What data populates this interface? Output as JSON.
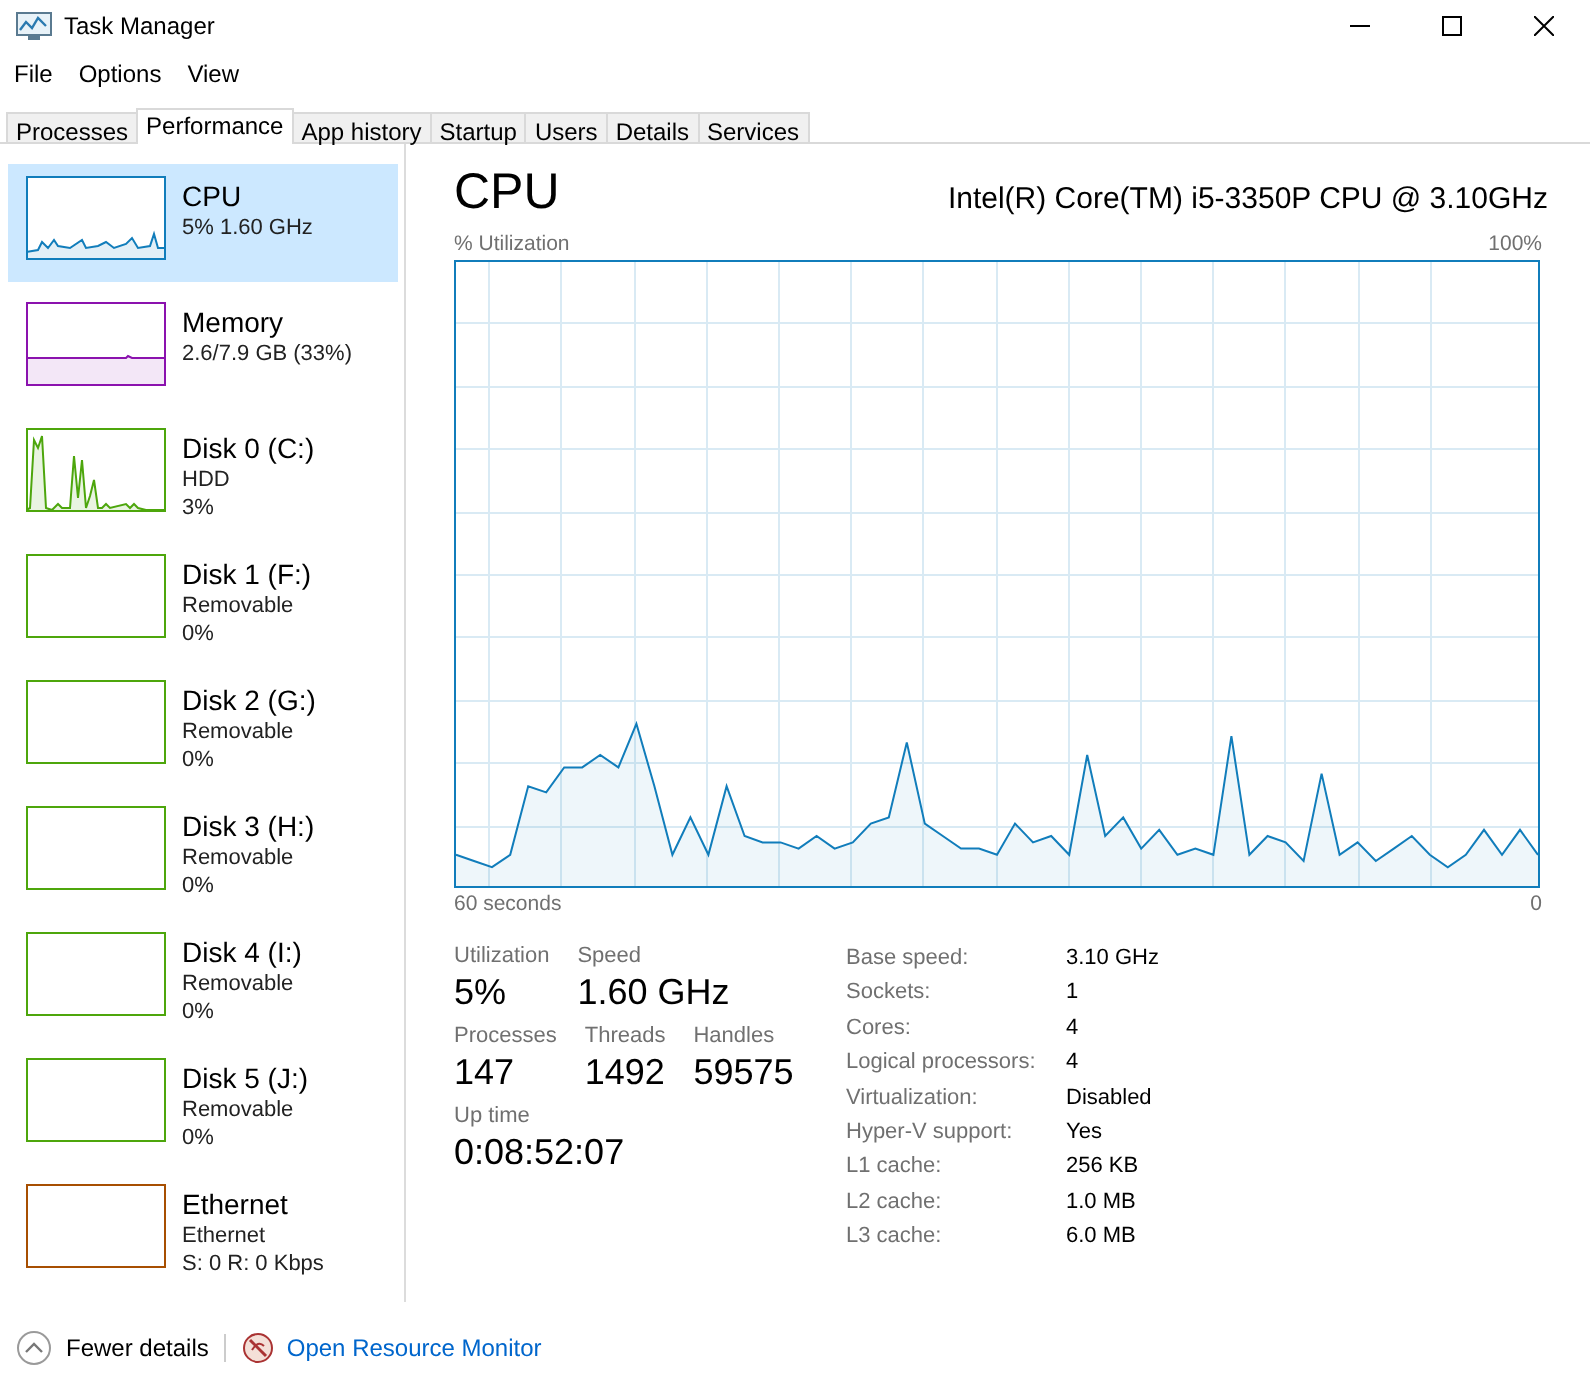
{
  "window": {
    "title": "Task Manager"
  },
  "menu": [
    "File",
    "Options",
    "View"
  ],
  "tabs": [
    {
      "label": "Processes",
      "selected": false
    },
    {
      "label": "Performance",
      "selected": true
    },
    {
      "label": "App history",
      "selected": false
    },
    {
      "label": "Startup",
      "selected": false
    },
    {
      "label": "Users",
      "selected": false
    },
    {
      "label": "Details",
      "selected": false
    },
    {
      "label": "Services",
      "selected": false
    }
  ],
  "sidebar": {
    "items": [
      {
        "kind": "cpu",
        "name": "CPU",
        "lines": [
          "5% 1.60 GHz"
        ],
        "selected": true,
        "color": "#117dbb"
      },
      {
        "kind": "memory",
        "name": "Memory",
        "lines": [
          "2.6/7.9 GB (33%)"
        ],
        "selected": false,
        "color": "#8b12ae"
      },
      {
        "kind": "disk-busy",
        "name": "Disk 0 (C:)",
        "lines": [
          "HDD",
          "3%"
        ],
        "selected": false,
        "color": "#4da60c"
      },
      {
        "kind": "disk",
        "name": "Disk 1 (F:)",
        "lines": [
          "Removable",
          "0%"
        ],
        "selected": false,
        "color": "#4da60c"
      },
      {
        "kind": "disk",
        "name": "Disk 2 (G:)",
        "lines": [
          "Removable",
          "0%"
        ],
        "selected": false,
        "color": "#4da60c"
      },
      {
        "kind": "disk",
        "name": "Disk 3 (H:)",
        "lines": [
          "Removable",
          "0%"
        ],
        "selected": false,
        "color": "#4da60c"
      },
      {
        "kind": "disk",
        "name": "Disk 4 (I:)",
        "lines": [
          "Removable",
          "0%"
        ],
        "selected": false,
        "color": "#4da60c"
      },
      {
        "kind": "disk",
        "name": "Disk 5 (J:)",
        "lines": [
          "Removable",
          "0%"
        ],
        "selected": false,
        "color": "#4da60c"
      },
      {
        "kind": "network",
        "name": "Ethernet",
        "lines": [
          "Ethernet",
          "S: 0 R: 0 Kbps"
        ],
        "selected": false,
        "color": "#a74f01"
      }
    ]
  },
  "detail": {
    "title": "CPU",
    "model": "Intel(R) Core(TM) i5-3350P CPU @ 3.10GHz",
    "graph": {
      "utilization_label": "% Utilization",
      "max_label": "100%",
      "span_label": "60 seconds",
      "min_label": "0"
    },
    "stats": [
      [
        {
          "label": "Utilization",
          "value": "5%"
        },
        {
          "label": "Speed",
          "value": "1.60 GHz"
        }
      ],
      [
        {
          "label": "Processes",
          "value": "147"
        },
        {
          "label": "Threads",
          "value": "1492"
        },
        {
          "label": "Handles",
          "value": "59575"
        }
      ],
      [
        {
          "label": "Up time",
          "value": "0:08:52:07"
        }
      ]
    ],
    "specs": [
      {
        "label": "Base speed:",
        "value": "3.10 GHz"
      },
      {
        "label": "Sockets:",
        "value": "1"
      },
      {
        "label": "Cores:",
        "value": "4"
      },
      {
        "label": "Logical processors:",
        "value": "4"
      },
      {
        "label": "Virtualization:",
        "value": "Disabled"
      },
      {
        "label": "Hyper-V support:",
        "value": "Yes"
      },
      {
        "label": "L1 cache:",
        "value": "256 KB"
      },
      {
        "label": "L2 cache:",
        "value": "1.0 MB"
      },
      {
        "label": "L3 cache:",
        "value": "6.0 MB"
      }
    ]
  },
  "footer": {
    "fewer_details": "Fewer details",
    "resource_monitor": "Open Resource Monitor"
  }
}
